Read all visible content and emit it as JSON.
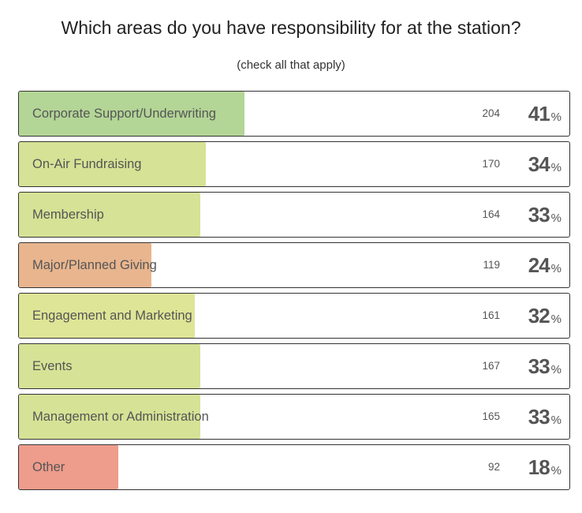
{
  "chart_data": {
    "type": "bar",
    "orientation": "horizontal",
    "title": "Which areas do you have responsibility for at the station?",
    "subtitle": "(check all that apply)",
    "categories": [
      "Corporate Support/Underwriting",
      "On-Air Fundraising",
      "Membership",
      "Major/Planned Giving",
      "Engagement and Marketing",
      "Events",
      "Management or Administration",
      "Other"
    ],
    "counts": [
      204,
      170,
      164,
      119,
      161,
      167,
      165,
      92
    ],
    "percents": [
      41,
      34,
      33,
      24,
      32,
      33,
      33,
      18
    ],
    "percent_sign": "%",
    "colors": [
      "#b3d596",
      "#d6e295",
      "#d6e295",
      "#e8b58e",
      "#dfe596",
      "#d6e295",
      "#d6e295",
      "#ee9c8c"
    ],
    "xlim": [
      0,
      100
    ]
  }
}
